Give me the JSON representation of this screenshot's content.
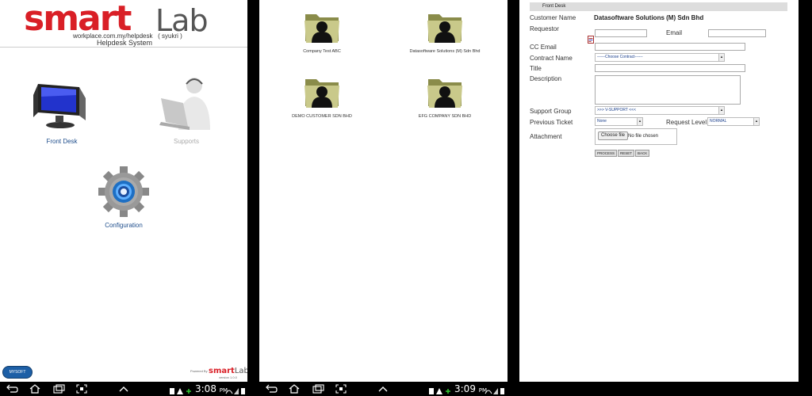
{
  "panel1": {
    "logo": {
      "smart": "smart",
      "lab": "Lab"
    },
    "url_line": "workplace.com.my/helpdesk   ( syukri )",
    "system_title": "Helpdesk System",
    "menu": [
      {
        "label": "Front Desk",
        "icon": "monitor-icon",
        "active": true
      },
      {
        "label": "Supports",
        "icon": "support-agent-icon",
        "active": false
      },
      {
        "label": "Configuration",
        "icon": "gear-icon",
        "active": true
      }
    ],
    "footer": {
      "badge": "MYSOFT",
      "powered": "Powered By",
      "powered_logo_smart": "smart",
      "powered_logo_lab": "Lab",
      "version": "version 1.0.0"
    }
  },
  "panel2": {
    "folders": [
      {
        "label": "Company Test ABC"
      },
      {
        "label": "Datasoftware Solutions (M) Sdn Bhd"
      },
      {
        "label": "DEMO CUSTOMER SDN BHD"
      },
      {
        "label": "EFG COMPANY SDN BHD"
      }
    ]
  },
  "panel3": {
    "header": "Front Desk",
    "customer_name_label": "Customer Name",
    "customer_name_value": "Datasoftware Solutions (M) Sdn Bhd",
    "requestor_label": "Requestor",
    "email_label": "Email",
    "cc_email_label": "CC Email",
    "contract_name_label": "Contract Name",
    "contract_select": "------Choose Contract------",
    "title_label": "Title",
    "description_label": "Description",
    "support_group_label": "Support Group",
    "support_group_select": ">>> V-SUPPORT <<<",
    "previous_ticket_label": "Previous Ticket",
    "previous_ticket_select": "None",
    "request_level_label": "Request Level",
    "request_level_select": "NORMAL",
    "attachment_label": "Attachment",
    "choose_file_label": "Choose file",
    "no_file_label": "No file chosen",
    "buttons": {
      "process": "PROCESS",
      "reset": "RESET",
      "back": "BACK"
    }
  },
  "system_bar": {
    "left_clock": "3:08",
    "left_ampm": "PM",
    "right_clock": "3:09",
    "right_ampm": "PM"
  }
}
